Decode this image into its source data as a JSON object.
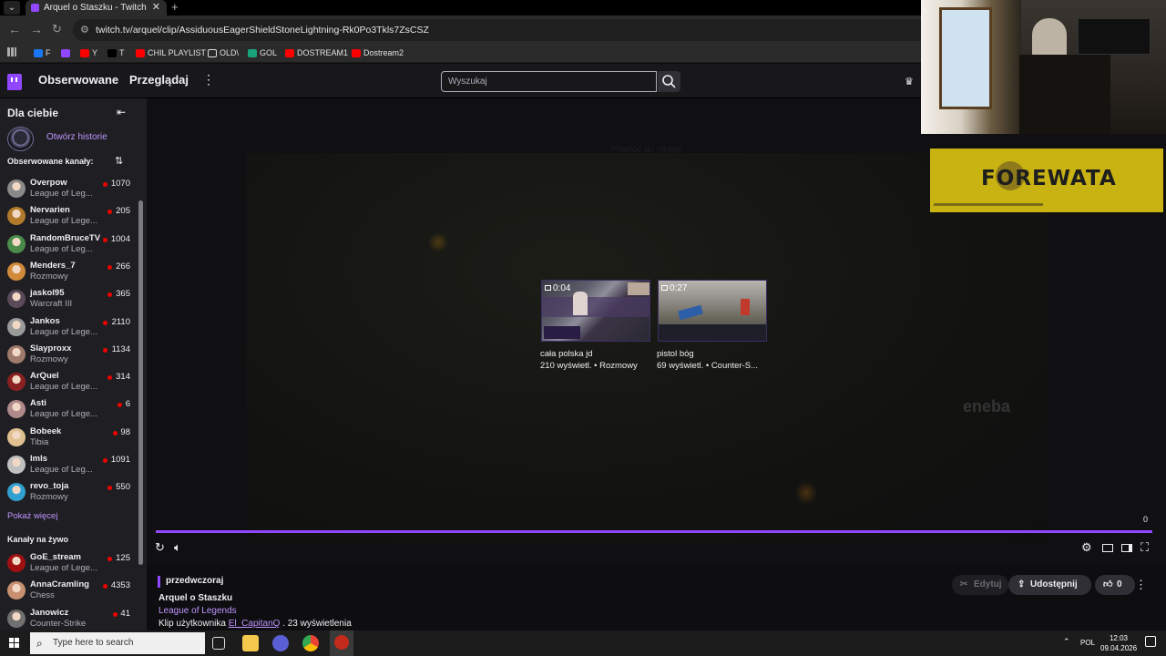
{
  "browser": {
    "tab_title": "Arquel o Staszku - Twitch",
    "url": "twitch.tv/arquel/clip/AssiduousEagerShieldStoneLightning-Rk0Po3Tkls7ZsCSZ",
    "bookmarks": [
      {
        "label": "F",
        "icon": "facebook-icon",
        "color": "#1877f2"
      },
      {
        "label": "",
        "icon": "twitch-icon",
        "color": "#9147ff"
      },
      {
        "label": "Y",
        "icon": "youtube-icon",
        "color": "#ff0000"
      },
      {
        "label": "T",
        "icon": "x-icon",
        "color": "#000000"
      },
      {
        "label": "CHIL PLAYLIST",
        "icon": "youtube-icon",
        "color": "#ff0000"
      },
      {
        "label": "OLD\\",
        "icon": "folder-icon",
        "color": "#2b2b2b"
      },
      {
        "label": "GOL",
        "icon": "gol-icon",
        "color": "#1aa37a"
      },
      {
        "label": "DOSTREAM1",
        "icon": "youtube-icon",
        "color": "#ff0000"
      },
      {
        "label": "Dostream2",
        "icon": "youtube-icon",
        "color": "#ff0000"
      }
    ]
  },
  "topnav": {
    "following": "Obserwowane",
    "browse": "Przeglądaj",
    "search_placeholder": "Wyszukaj"
  },
  "sidebar": {
    "title": "Dla ciebie",
    "history_link": "Otwórz historie",
    "followed_title": "Obserwowane kanały:",
    "followed": [
      {
        "name": "Overpow",
        "game": "League of Leg...",
        "viewers": "1070",
        "avatar": "#8a8a8a"
      },
      {
        "name": "Nervarien",
        "game": "League of Lege...",
        "viewers": "205",
        "avatar": "#b07a2a"
      },
      {
        "name": "RandomBruceTV",
        "game": "League of Leg...",
        "viewers": "1004",
        "avatar": "#4a8a4a"
      },
      {
        "name": "Menders_7",
        "game": "Rozmowy",
        "viewers": "266",
        "avatar": "#d08a3a"
      },
      {
        "name": "jaskol95",
        "game": "Warcraft III",
        "viewers": "365",
        "avatar": "#5a4a5a"
      },
      {
        "name": "Jankos",
        "game": "League of Lege...",
        "viewers": "2110",
        "avatar": "#9a9a9a"
      },
      {
        "name": "Slayproxx",
        "game": "Rozmowy",
        "viewers": "1134",
        "avatar": "#a07a6a"
      },
      {
        "name": "ArQuel",
        "game": "League of Lege...",
        "viewers": "314",
        "avatar": "#8a2020"
      },
      {
        "name": "Asti",
        "game": "League of Lege...",
        "viewers": "6",
        "avatar": "#b08a8a"
      },
      {
        "name": "Bobeek",
        "game": "Tibia",
        "viewers": "98",
        "avatar": "#e0c090"
      },
      {
        "name": "lmls",
        "game": "League of Leg...",
        "viewers": "1091",
        "avatar": "#c0c0c0"
      },
      {
        "name": "revo_toja",
        "game": "Rozmowy",
        "viewers": "550",
        "avatar": "#30a0d0"
      }
    ],
    "show_more": "Pokaż więcej",
    "live_title": "Kanały na żywo",
    "live": [
      {
        "name": "GoE_stream",
        "game": "League of Lege...",
        "viewers": "125",
        "avatar": "#a01010"
      },
      {
        "name": "AnnaCramling",
        "game": "Chess",
        "viewers": "4353",
        "avatar": "#c89070"
      },
      {
        "name": "Janowicz",
        "game": "Counter-Strike",
        "viewers": "41",
        "avatar": "#707070"
      }
    ]
  },
  "player": {
    "ghost_title": "Powróć do strony",
    "sponsor": "eneba",
    "time_end": "0",
    "clips": [
      {
        "duration": "0:04",
        "title": "cała polska jd",
        "meta": "210 wyświetl. • Rozmowy"
      },
      {
        "duration": "0:27",
        "title": "pistol bóg",
        "meta": "69 wyświetl. • Counter-S..."
      }
    ]
  },
  "overlay": {
    "sponsor_text": "FOREWATA"
  },
  "clip_info": {
    "date": "przedwczoraj",
    "title": "Arquel o Staszku",
    "game": "League of Legends",
    "by_prefix": "Klip użytkownika",
    "author": "El_CapitanQ",
    "views": ". 23 wyświetlenia",
    "edit": "Edytuj",
    "share": "Udostępnij",
    "likes": "0"
  },
  "taskbar": {
    "search_placeholder": "Type here to search",
    "lang": "POL",
    "time": "12:03",
    "date": "09.04.2026"
  }
}
